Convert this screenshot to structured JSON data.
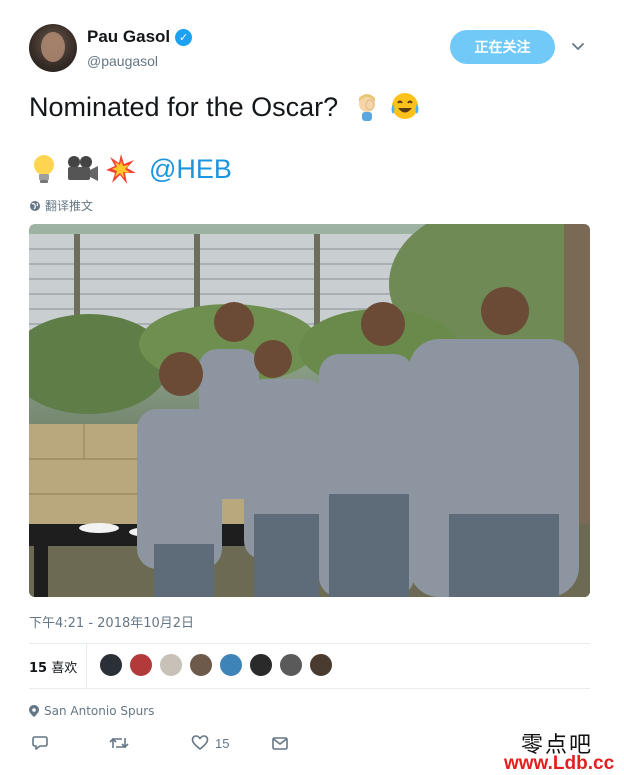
{
  "user": {
    "display_name": "Pau Gasol",
    "handle": "@paugasol",
    "verified": true
  },
  "header": {
    "follow_label": "正在关注",
    "caret_icon": "chevron-down-icon"
  },
  "tweet": {
    "text": "Nominated for the Oscar?",
    "text_emojis": [
      "facepalm-woman-emoji",
      "tears-of-joy-emoji"
    ],
    "line2_emojis": [
      "light-bulb-emoji",
      "movie-camera-emoji",
      "collision-emoji"
    ],
    "mention": "@HEB",
    "translate_label": "翻译推文"
  },
  "meta": {
    "timestamp": "下午4:21 - 2018年10月2日",
    "likes_count": "15",
    "likes_label": "喜欢",
    "location": "San Antonio Spurs"
  },
  "actions": {
    "reply_icon": "reply-icon",
    "retweet_icon": "retweet-icon",
    "like_icon": "heart-icon",
    "like_count": "15",
    "message_icon": "envelope-icon"
  },
  "watermark": {
    "cn": "零点吧",
    "url": "www.Ldb.cc"
  },
  "colors": {
    "accent": "#1da1f2",
    "follow_button": "#71c9f8",
    "mention": "#1b95e0",
    "secondary_text": "#657786",
    "watermark_url": "#e32020"
  }
}
